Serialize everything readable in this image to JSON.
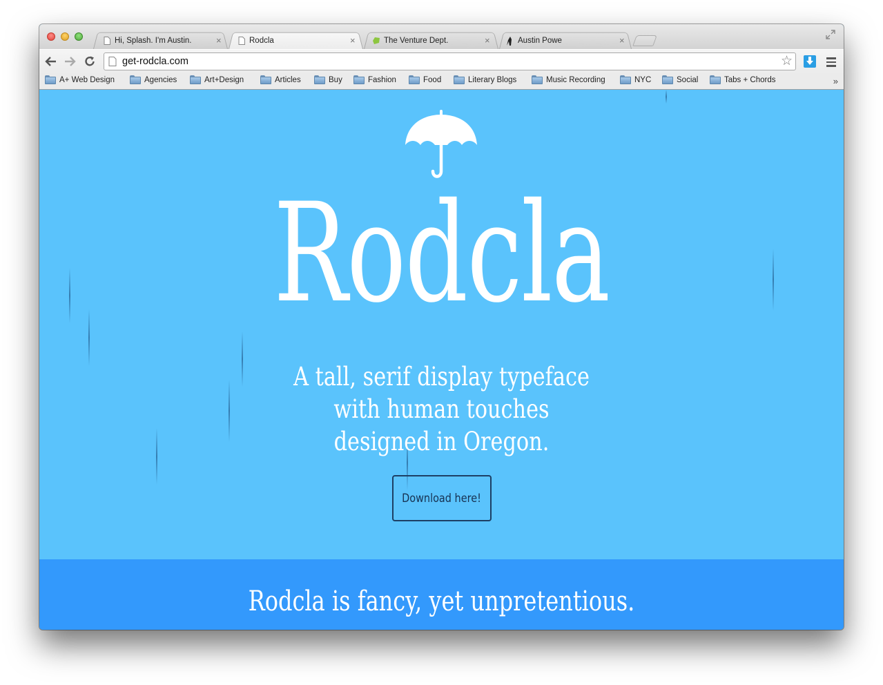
{
  "browser": {
    "tabs": [
      {
        "title": "Hi, Splash. I'm Austin.",
        "active": false,
        "favicon": "page-icon"
      },
      {
        "title": "Rodcla",
        "active": true,
        "favicon": "page-icon"
      },
      {
        "title": "The Venture Dept.",
        "active": false,
        "favicon": "green-leaf-icon"
      },
      {
        "title": "Austin Powe",
        "active": false,
        "favicon": "silhouette-icon"
      }
    ],
    "url": "get-rodcla.com",
    "bookmarks": [
      "A+ Web Design",
      "Agencies",
      "Art+Design",
      "Articles",
      "Buy",
      "Fashion",
      "Food",
      "Literary Blogs",
      "Music Recording",
      "NYC",
      "Social",
      "Tabs + Chords"
    ],
    "bookmarks_overflow": "»"
  },
  "page": {
    "logo_icon": "umbrella-icon",
    "brand": "Rodcla",
    "tagline": [
      "A tall, serif display typeface",
      "with human touches",
      "designed in Oregon."
    ],
    "download_label": "Download here!",
    "band_text": "Rodcla is fancy, yet unpretentious."
  },
  "colors": {
    "hero_background": "#5ac3fc",
    "band_background": "#3399fc",
    "text": "#ffffff",
    "button_border": "#1d3f64"
  }
}
